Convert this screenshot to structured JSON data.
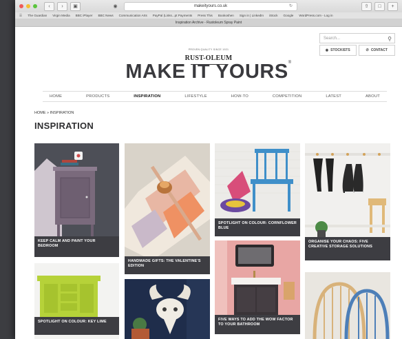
{
  "browser": {
    "url": "makeityours.co.uk",
    "tab_title": "Inspiration Archive - Rustoleum Spray Paint",
    "bookmarks": [
      "The Guardian",
      "Virgin Media",
      "BBC iPlayer",
      "BBC News",
      "Communication Arts",
      "PayPal (Links...pt Payments",
      "Press This",
      "Bookoshen",
      "Sign in | LinkedIn",
      "iStock",
      "Google",
      "WordPress.com - Log in"
    ]
  },
  "utility": {
    "search_placeholder": "Search...",
    "stockists_label": "STOCKISTS",
    "contact_label": "CONTACT"
  },
  "logo": {
    "tagline": "PROVEN QUALITY SINCE 1921",
    "brand": "RUST-OLEUM",
    "headline": "MAKE IT YOURS",
    "tm": "®"
  },
  "nav": {
    "items": [
      "HOME",
      "PRODUCTS",
      "INSPIRATION",
      "LIFESTYLE",
      "HOW-TO",
      "COMPETITION",
      "LATEST",
      "ABOUT"
    ],
    "active": "INSPIRATION"
  },
  "breadcrumb": "HOME » INSPIRATION",
  "page_title": "INSPIRATION",
  "tiles": [
    {
      "caption": "KEEP CALM AND PAINT YOUR BEDROOM"
    },
    {
      "caption": "HANDMADE GIFTS: THE VALENTINE'S EDITION"
    },
    {
      "caption": "SPOTLIGHT ON COLOUR: CORNFLOWER BLUE"
    },
    {
      "caption": "ORGANISE YOUR CHAOS: FIVE CREATIVE STORAGE SOLUTIONS"
    },
    {
      "caption": "SPOTLIGHT ON COLOUR: KEY LIME"
    },
    {
      "caption": "FIVE WAYS TO ADD THE WOW FACTOR TO YOUR BATHROOM"
    }
  ],
  "colors": {
    "caption_bg": "#3d3d42",
    "headline": "#3a3a3e"
  }
}
